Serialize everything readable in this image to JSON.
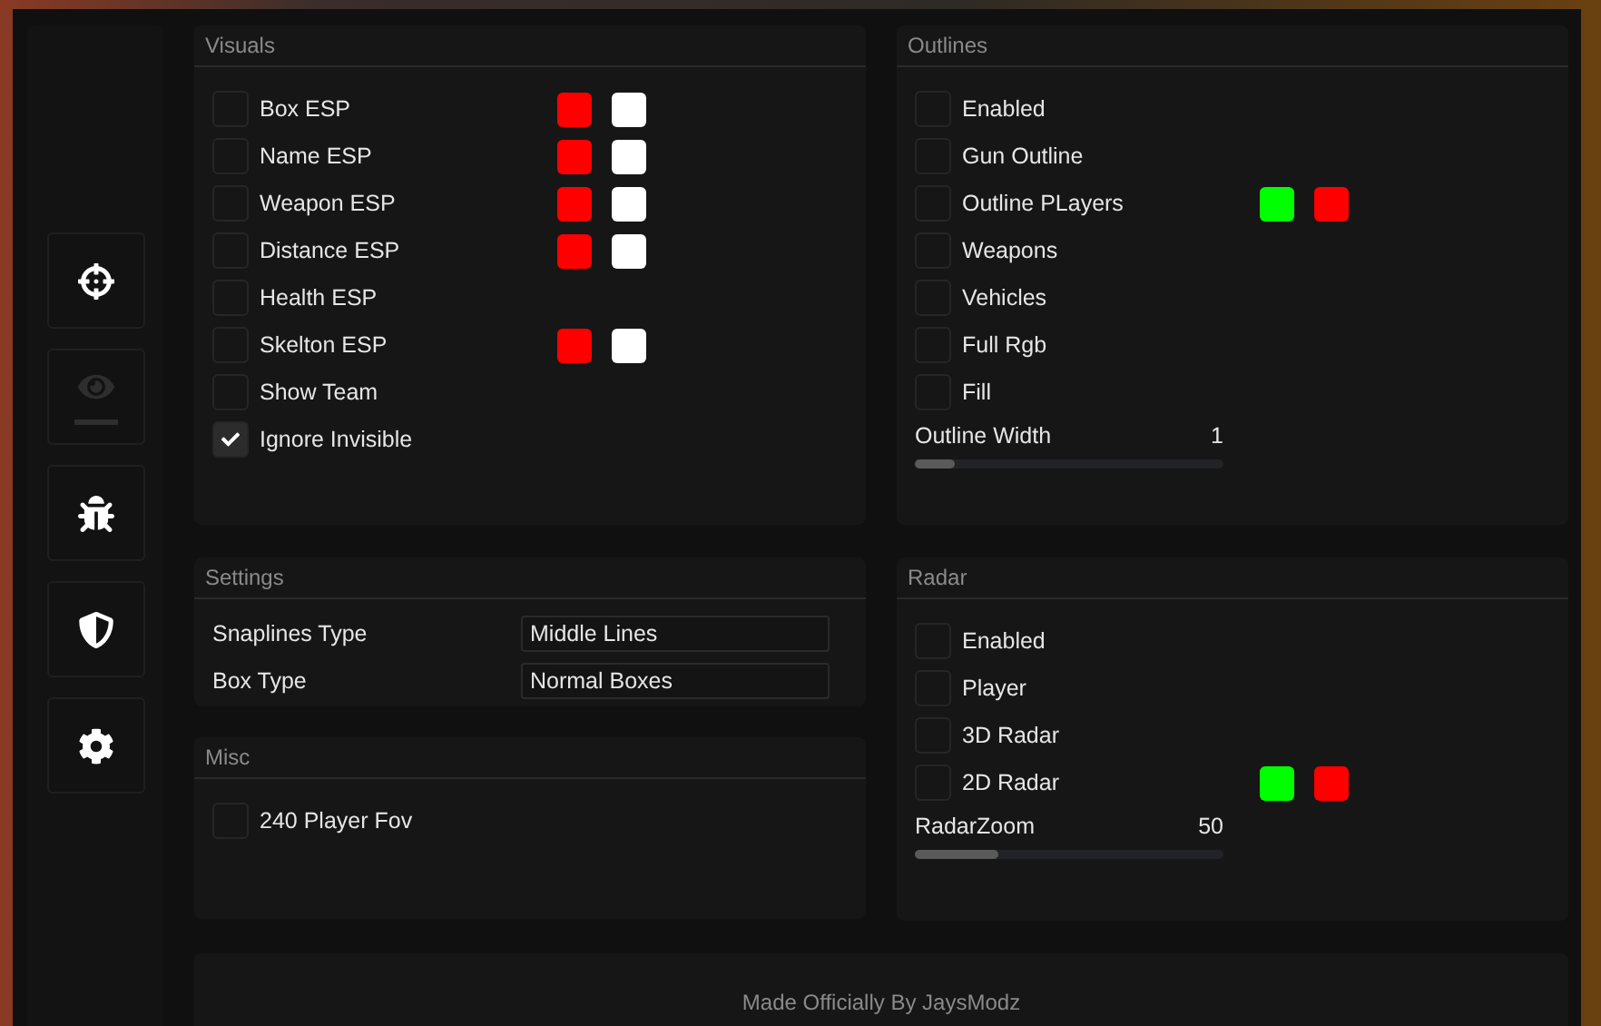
{
  "sidebar": {
    "items": [
      {
        "kind": "crosshair",
        "selected": false
      },
      {
        "kind": "eye",
        "selected": true
      },
      {
        "kind": "bug",
        "selected": false
      },
      {
        "kind": "shield",
        "selected": false
      },
      {
        "kind": "gear",
        "selected": false
      }
    ]
  },
  "visuals": {
    "title": "Visuals",
    "items": [
      {
        "label": "Box ESP",
        "checked": false,
        "swatches": [
          {
            "color": "#ff0000"
          },
          {
            "color": "#ffffff"
          }
        ]
      },
      {
        "label": "Name ESP",
        "checked": false,
        "swatches": [
          {
            "color": "#ff0000"
          },
          {
            "color": "#ffffff"
          }
        ]
      },
      {
        "label": "Weapon ESP",
        "checked": false,
        "swatches": [
          {
            "color": "#ff0000"
          },
          {
            "color": "#ffffff"
          }
        ]
      },
      {
        "label": "Distance ESP",
        "checked": false,
        "swatches": [
          {
            "color": "#ff0000"
          },
          {
            "color": "#ffffff"
          }
        ]
      },
      {
        "label": "Health ESP",
        "checked": false
      },
      {
        "label": "Skelton ESP",
        "checked": false,
        "swatches": [
          {
            "color": "#ff0000"
          },
          {
            "color": "#ffffff"
          }
        ]
      },
      {
        "label": "Show Team",
        "checked": false
      },
      {
        "label": "Ignore Invisible",
        "checked": true
      }
    ]
  },
  "outlines": {
    "title": "Outlines",
    "items": [
      {
        "label": "Enabled",
        "checked": false
      },
      {
        "label": "Gun Outline",
        "checked": false
      },
      {
        "label": "Outline PLayers",
        "checked": false,
        "swatches": [
          {
            "color": "#00ff00"
          },
          {
            "color": "#ff0000"
          }
        ]
      },
      {
        "label": "Weapons",
        "checked": false
      },
      {
        "label": "Vehicles",
        "checked": false
      },
      {
        "label": "Full Rgb",
        "checked": false
      },
      {
        "label": "Fill",
        "checked": false
      }
    ],
    "slider": {
      "label": "Outline Width",
      "reading": "1",
      "level": 0.13
    }
  },
  "settings": {
    "title": "Settings",
    "fields": [
      {
        "label": "Snaplines Type",
        "value": "Middle Lines"
      },
      {
        "label": "Box Type",
        "value": "Normal Boxes"
      }
    ]
  },
  "misc": {
    "title": "Misc",
    "items": [
      {
        "label": "240 Player Fov",
        "checked": false
      }
    ]
  },
  "radar": {
    "title": "Radar",
    "items": [
      {
        "label": "Enabled",
        "checked": false
      },
      {
        "label": "Player",
        "checked": false
      },
      {
        "label": "3D Radar",
        "checked": false
      },
      {
        "label": "2D Radar",
        "checked": false,
        "swatches": [
          {
            "color": "#00ff00"
          },
          {
            "color": "#ff0000"
          }
        ]
      }
    ],
    "slider": {
      "label": "RadarZoom",
      "reading": "50",
      "level": 0.27
    }
  },
  "footer": {
    "text": "Made Officially By JaysModz"
  }
}
